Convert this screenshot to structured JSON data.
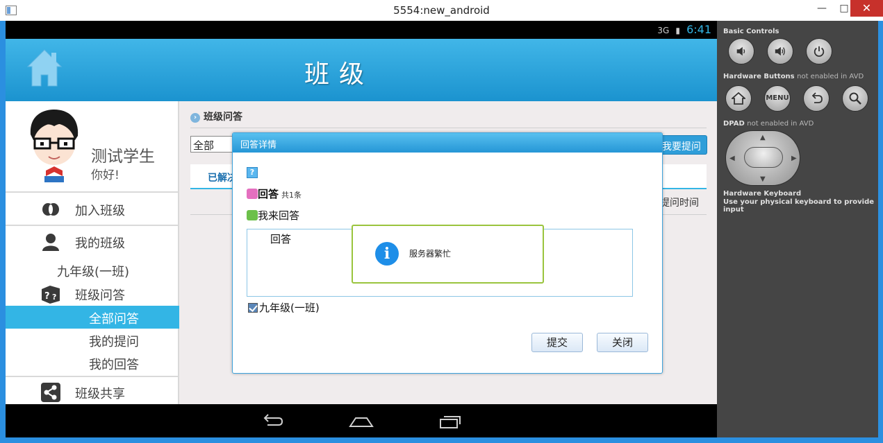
{
  "window": {
    "title": "5554:new_android",
    "min_glyph": "—",
    "max_glyph": "□",
    "close_glyph": "✕"
  },
  "statusbar": {
    "signal_text": "3G",
    "time": "6:41"
  },
  "header": {
    "title": "班级"
  },
  "profile": {
    "name": "测试学生",
    "greeting": "你好!"
  },
  "sidebar": {
    "join_class": "加入班级",
    "my_class": "我的班级",
    "class_name": "九年级(一班)",
    "class_qa": "班级问答",
    "sub_items": [
      "全部问答",
      "我的提问",
      "我的回答"
    ],
    "class_share": "班级共享"
  },
  "main": {
    "section_title": "班级问答",
    "filter_value": "全部",
    "ask_button": "我要提问",
    "tab_label": "已解决",
    "col_header": "提问时间"
  },
  "dialog": {
    "title": "回答详情",
    "question_badge": "?",
    "answers_title": "回答",
    "answers_count": "共1条",
    "my_answer": "我来回答",
    "answer_text": "回答",
    "class_checkbox": "九年级(一班)",
    "submit": "提交",
    "close": "关闭"
  },
  "toast": {
    "message": "服务器繁忙"
  },
  "emulator": {
    "basic_controls": "Basic Controls",
    "hw_buttons": "Hardware Buttons",
    "hw_buttons_note": "not enabled in AVD",
    "menu_label": "MENU",
    "dpad": "DPAD",
    "dpad_note": "not enabled in AVD",
    "hw_keyboard": "Hardware Keyboard",
    "hw_keyboard_note": "Use your physical keyboard to provide input"
  },
  "colors": {
    "accent": "#33b5e5",
    "header": "#1b93cf",
    "toast_border": "#9ac43d"
  }
}
